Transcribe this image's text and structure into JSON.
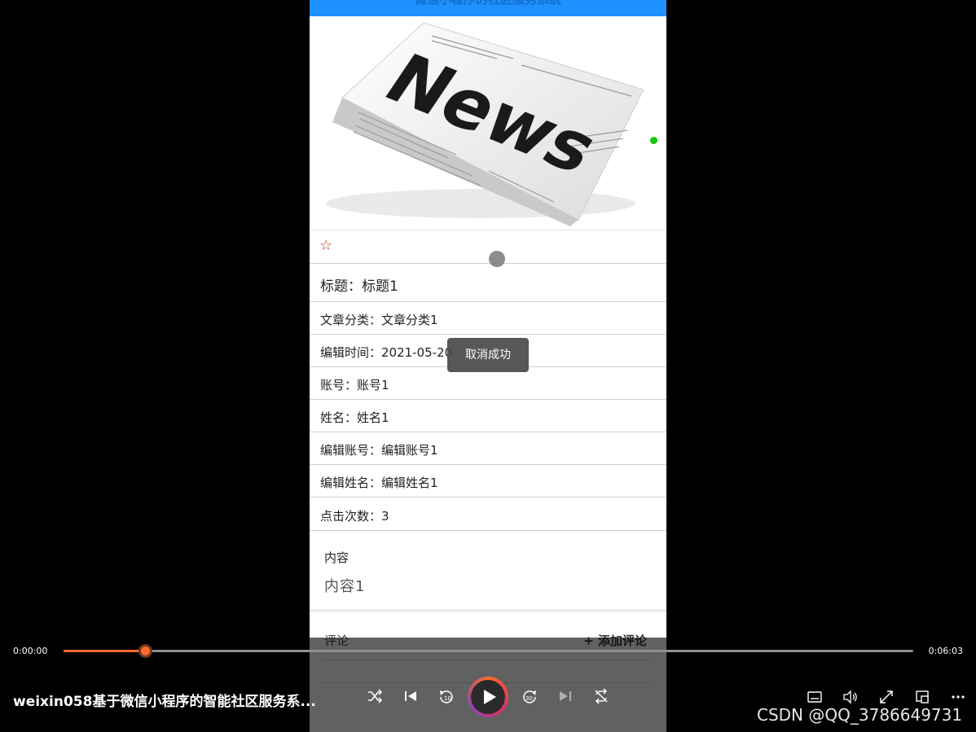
{
  "header": {
    "title": "微信小程序的社区服务系统"
  },
  "hero": {
    "image_text": "News"
  },
  "detail": {
    "title_row": "标题：标题1",
    "category_row": "文章分类：文章分类1",
    "edit_time_row": "编辑时间：2021-05-20",
    "account_row": "账号：账号1",
    "name_row": "姓名：姓名1",
    "editor_account_row": "编辑账号：编辑账号1",
    "editor_name_row": "编辑姓名：编辑姓名1",
    "clicks_row": "点击次数：3"
  },
  "content": {
    "label": "内容",
    "value": "内容1"
  },
  "comments": {
    "label": "评论",
    "add_label": "+ 添加评论"
  },
  "toast": {
    "text": "取消成功"
  },
  "player": {
    "current_time": "0:00:00",
    "total_time": "0:06:03",
    "progress": 0.096,
    "title": "weixin058基于微信小程序的智能社区服务系..."
  },
  "watermark": "CSDN @QQ_3786649731",
  "colors": {
    "accent": "#ff6a2c",
    "header_blue": "#1e90ff",
    "star": "#c0392b"
  }
}
